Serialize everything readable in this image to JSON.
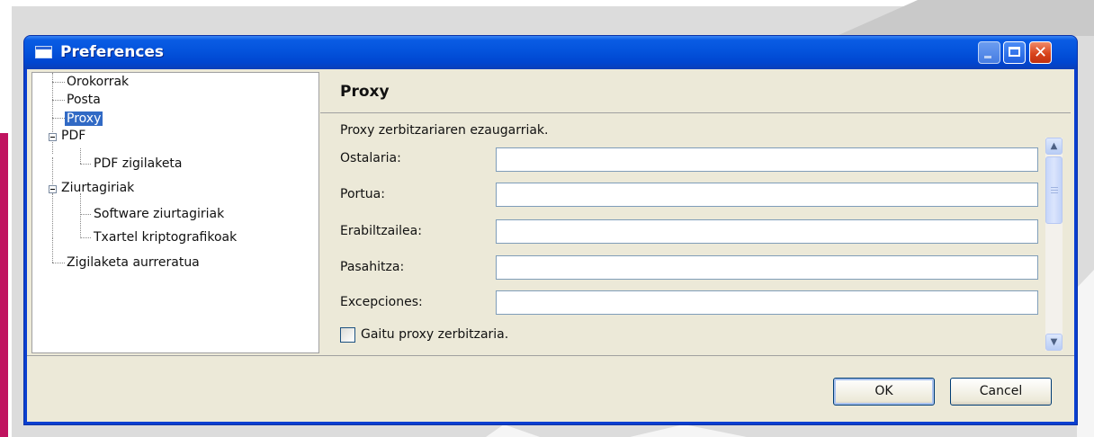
{
  "window": {
    "title": "Preferences"
  },
  "tree": {
    "items": [
      {
        "label": "Orokorrak"
      },
      {
        "label": "Posta"
      },
      {
        "label": "Proxy",
        "selected": true
      },
      {
        "label": "PDF",
        "expanded": true
      },
      {
        "label": "PDF zigilaketa"
      },
      {
        "label": "Ziurtagiriak",
        "expanded": true
      },
      {
        "label": "Software ziurtagiriak"
      },
      {
        "label": "Txartel kriptografikoak"
      },
      {
        "label": "Zigilaketa aurreratua"
      }
    ]
  },
  "pane": {
    "title": "Proxy",
    "description": "Proxy zerbitzariaren ezaugarriak.",
    "fields": [
      {
        "label": "Ostalaria:",
        "value": ""
      },
      {
        "label": "Portua:",
        "value": ""
      },
      {
        "label": "Erabiltzailea:",
        "value": ""
      },
      {
        "label": "Pasahitza:",
        "value": ""
      },
      {
        "label": "Excepciones:",
        "value": ""
      }
    ],
    "checkbox": {
      "label": "Gaitu proxy zerbitzaria.",
      "checked": false
    }
  },
  "buttons": {
    "ok": "OK",
    "cancel": "Cancel"
  },
  "icons": {
    "window": "window-icon",
    "minimize": "minimize-icon",
    "maximize": "maximize-icon",
    "close": "close-icon",
    "scroll_up": "chevron-up-icon",
    "scroll_down": "chevron-down-icon"
  },
  "colors": {
    "titlebar": "#0453dc",
    "selection": "#316ac5",
    "close_button": "#d9451c",
    "accent": "#c0135f"
  }
}
